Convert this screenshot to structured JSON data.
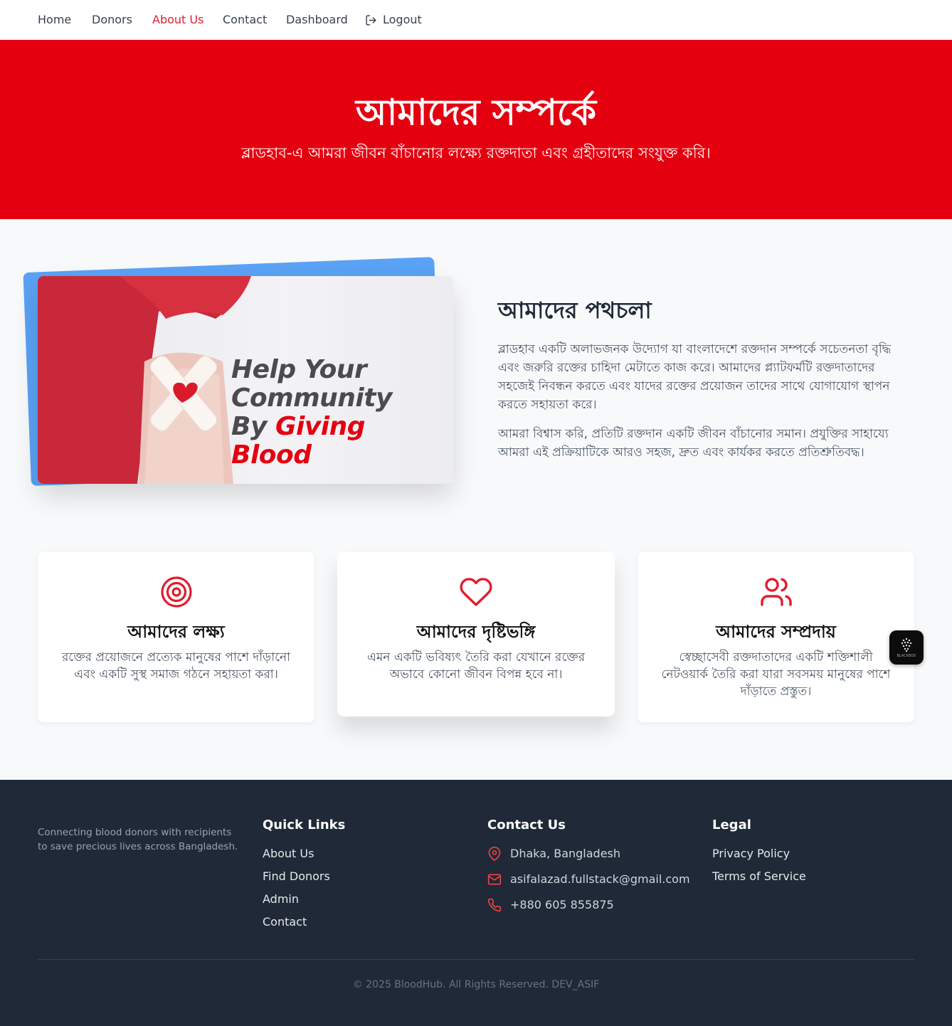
{
  "nav": {
    "items": [
      {
        "label": "Home"
      },
      {
        "label": "Donors"
      },
      {
        "label": "About Us"
      },
      {
        "label": "Contact"
      },
      {
        "label": "Dashboard"
      },
      {
        "label": "Logout"
      }
    ],
    "active": "About Us"
  },
  "hero": {
    "title": "আমাদের সম্পর্কে",
    "subtitle": "ব্লাডহাব-এ আমরা জীবন বাঁচানোর লক্ষ্যে রক্তদাতা এবং গ্রহীতাদের সংযুক্ত করি।"
  },
  "journey": {
    "image": {
      "line1": "Help Your",
      "line2": "Community",
      "line3_prefix": "By ",
      "line3_highlight": "Giving Blood"
    },
    "title": "আমাদের পথচলা",
    "paragraph1": "ব্লাডহাব একটি অলাভজনক উদ্যোগ যা বাংলাদেশে রক্তদান সম্পর্কে সচেতনতা বৃদ্ধি এবং জরুরি রক্তের চাহিদা মেটাতে কাজ করে। আমাদের প্ল্যাটফর্মটি রক্তদাতাদের সহজেই নিবন্ধন করতে এবং যাদের রক্তের প্রয়োজন তাদের সাথে যোগাযোগ স্থাপন করতে সহায়তা করে।",
    "paragraph2": "আমরা বিশ্বাস করি, প্রতিটি রক্তদান একটি জীবন বাঁচানোর সমান। প্রযুক্তির সাহায্যে আমরা এই প্রক্রিয়াটিকে আরও সহজ, দ্রুত এবং কার্যকর করতে প্রতিশ্রুতিবদ্ধ।"
  },
  "cards": [
    {
      "icon": "target-icon",
      "title": "আমাদের লক্ষ্য",
      "text": "রক্তের প্রয়োজনে প্রত্যেক মানুষের পাশে দাঁড়ানো এবং একটি সুস্থ সমাজ গঠনে সহায়তা করা।"
    },
    {
      "icon": "heart-icon",
      "title": "আমাদের দৃষ্টিভঙ্গি",
      "text": "এমন একটি ভবিষ্যৎ তৈরি করা যেখানে রক্তের অভাবে কোনো জীবন বিপন্ন হবে না।"
    },
    {
      "icon": "users-icon",
      "title": "আমাদের সম্প্রদায়",
      "text": "স্বেচ্ছাসেবী রক্তদাতাদের একটি শক্তিশালী নেটওয়ার্ক তৈরি করা যারা সবসময় মানুষের পাশে দাঁড়াতে প্রস্তুত।"
    }
  ],
  "floating_badge": {
    "label": "BLACKBOX"
  },
  "footer": {
    "about": "Connecting blood donors with recipients to save precious lives across Bangladesh.",
    "quick_links": {
      "title": "Quick Links",
      "items": [
        "About Us",
        "Find Donors",
        "Admin",
        "Contact"
      ]
    },
    "contact": {
      "title": "Contact Us",
      "address": "Dhaka, Bangladesh",
      "email": "asifalazad.fullstack@gmail.com",
      "phone": "+880 605 855875"
    },
    "legal": {
      "title": "Legal",
      "items": [
        "Privacy Policy",
        "Terms of Service"
      ]
    },
    "copyright": "© 2025 BloodHub. All Rights Reserved. DEV_ASIF"
  },
  "colors": {
    "brand_red": "#e50010",
    "accent_red": "#e11d2e",
    "footer_bg": "#1f2937",
    "image_back_blue": "#5aa2f5"
  }
}
